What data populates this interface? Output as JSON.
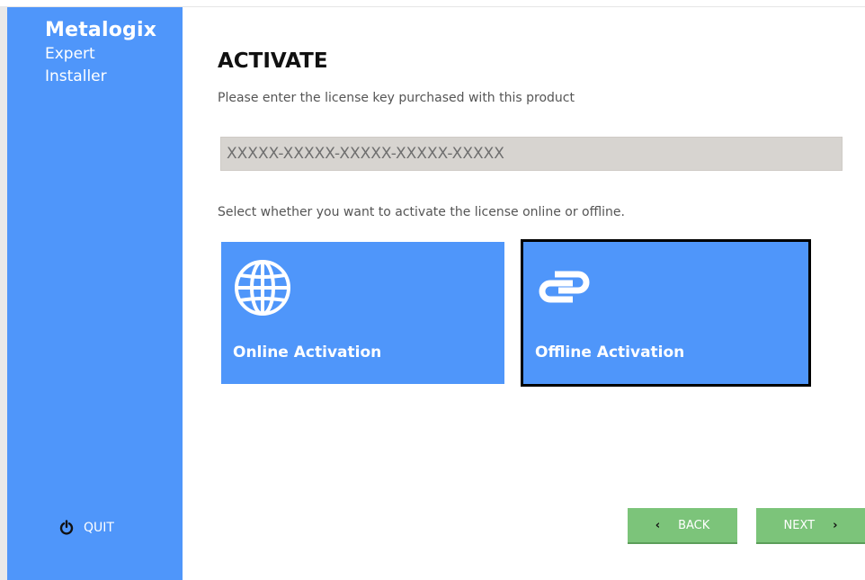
{
  "sidebar": {
    "brand": "Metalogix",
    "subtitle_line1": "Expert",
    "subtitle_line2": "Installer",
    "quit_label": "QUIT",
    "quit_icon": "power-icon",
    "background_color": "#4f96fa"
  },
  "main": {
    "title": "ACTIVATE",
    "instruction": "Please enter the license key purchased with this product",
    "license_placeholder": "XXXXX-XXXXX-XXXXX-XXXXX-XXXXX",
    "license_value": "",
    "select_instruction": "Select whether you want to activate the license online or offline.",
    "options": [
      {
        "label": "Online Activation",
        "icon": "globe-icon",
        "selected": false
      },
      {
        "label": "Offline Activation",
        "icon": "link-icon",
        "selected": true
      }
    ],
    "tile_color": "#4f96fa"
  },
  "footer": {
    "back_label": "BACK",
    "next_label": "NEXT",
    "button_color": "#7cc47a"
  }
}
